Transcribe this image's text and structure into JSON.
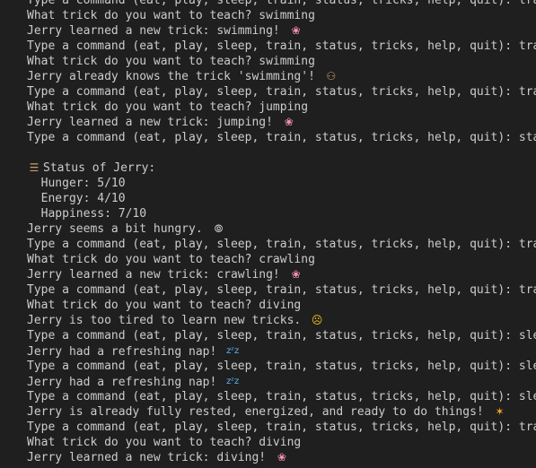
{
  "terminal": {
    "lines": [
      {
        "text": "Type a command (eat, play, sleep, train, status, tricks, help, quit): train",
        "icon": ""
      },
      {
        "text": "What trick do you want to teach? swimming",
        "icon": ""
      },
      {
        "text": "Jerry learned a new trick: swimming!",
        "icon": "brain"
      },
      {
        "text": "Type a command (eat, play, sleep, train, status, tricks, help, quit): train",
        "icon": ""
      },
      {
        "text": "What trick do you want to teach? swimming",
        "icon": ""
      },
      {
        "text": "Jerry already knows the trick 'swimming'!",
        "icon": "dog"
      },
      {
        "text": "Type a command (eat, play, sleep, train, status, tricks, help, quit): train",
        "icon": ""
      },
      {
        "text": "What trick do you want to teach? jumping",
        "icon": ""
      },
      {
        "text": "Jerry learned a new trick: jumping!",
        "icon": "brain"
      },
      {
        "text": "Type a command (eat, play, sleep, train, status, tricks, help, quit): status",
        "icon": ""
      },
      {
        "text": "",
        "icon": ""
      },
      {
        "text": "Status of Jerry:",
        "icon": "clipboard",
        "icon_first": true
      },
      {
        "text": "  Hunger: 5/10",
        "icon": ""
      },
      {
        "text": "  Energy: 4/10",
        "icon": ""
      },
      {
        "text": "  Happiness: 7/10",
        "icon": ""
      },
      {
        "text": "Jerry seems a bit hungry.",
        "icon": "plate"
      },
      {
        "text": "Type a command (eat, play, sleep, train, status, tricks, help, quit): train",
        "icon": ""
      },
      {
        "text": "What trick do you want to teach? crawling",
        "icon": ""
      },
      {
        "text": "Jerry learned a new trick: crawling!",
        "icon": "brain"
      },
      {
        "text": "Type a command (eat, play, sleep, train, status, tricks, help, quit): train",
        "icon": ""
      },
      {
        "text": "What trick do you want to teach? diving",
        "icon": ""
      },
      {
        "text": "Jerry is too tired to learn new tricks.",
        "icon": "dizzy"
      },
      {
        "text": "Type a command (eat, play, sleep, train, status, tricks, help, quit): sleep",
        "icon": ""
      },
      {
        "text": "Jerry had a refreshing nap!",
        "icon": "zzz"
      },
      {
        "text": "Type a command (eat, play, sleep, train, status, tricks, help, quit): sleep",
        "icon": ""
      },
      {
        "text": "Jerry had a refreshing nap!",
        "icon": "zzz"
      },
      {
        "text": "Type a command (eat, play, sleep, train, status, tricks, help, quit): sleep",
        "icon": ""
      },
      {
        "text": "Jerry is already fully rested, energized, and ready to do things!",
        "icon": "party"
      },
      {
        "text": "Type a command (eat, play, sleep, train, status, tricks, help, quit): train",
        "icon": ""
      },
      {
        "text": "What trick do you want to teach? diving",
        "icon": ""
      },
      {
        "text": "Jerry learned a new trick: diving!",
        "icon": "brain"
      }
    ]
  },
  "icons": {
    "brain": {
      "name": "brain-icon",
      "glyph": "❀"
    },
    "dog": {
      "name": "dog-face-icon",
      "glyph": "⚇"
    },
    "clipboard": {
      "name": "clipboard-icon",
      "glyph": "☰"
    },
    "plate": {
      "name": "plate-with-cutlery-icon",
      "glyph": "⦾"
    },
    "dizzy": {
      "name": "dizzy-face-icon",
      "glyph": "☹"
    },
    "zzz": {
      "name": "zzz-icon",
      "glyph": "zᶻz"
    },
    "party": {
      "name": "party-popper-icon",
      "glyph": "✶"
    }
  },
  "colors": {
    "background": "#1f1f1f",
    "text": "#cccccc"
  }
}
